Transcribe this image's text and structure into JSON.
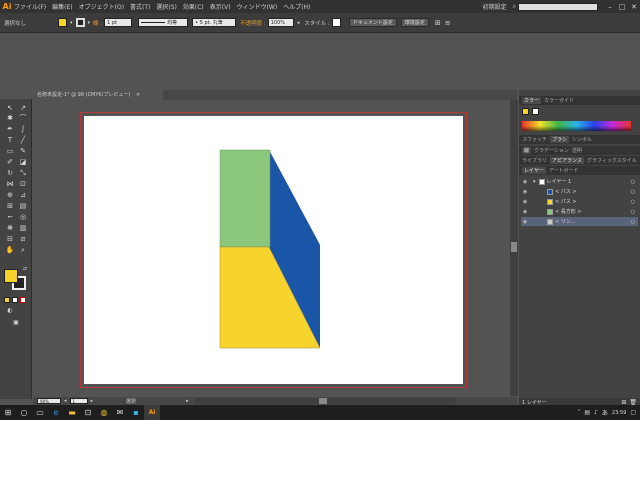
{
  "app": {
    "logo": "Ai",
    "menus": [
      "ファイル(F)",
      "編集(E)",
      "オブジェクト(O)",
      "書式(T)",
      "選択(S)",
      "効果(C)",
      "表示(V)",
      "ウィンドウ(W)",
      "ヘルプ(H)"
    ],
    "workspace": "初期設定",
    "search_placeholder": "",
    "window_controls": [
      "–",
      "□",
      "✕"
    ]
  },
  "control_bar": {
    "selection": "選択なし",
    "stroke_label": "線 :",
    "stroke_width": "1 pt",
    "stroke_style": "均等",
    "brush": "5 pt. 丸筆",
    "opacity_label": "不透明度 :",
    "opacity": "100%",
    "style_label": "スタイル :",
    "doc_settings_button": "ドキュメント設定",
    "prefs_button": "環境設定",
    "fill_color": "#f6d32d",
    "stroke_color": "#000000"
  },
  "document": {
    "tab_title": "名称未設定-1* @ 98 (CMYK/プレビュー)",
    "zoom": "98%",
    "page": "1",
    "status_text": "選択"
  },
  "shapes": {
    "green_fill": "#8bc77b",
    "yellow_fill": "#f6d32d",
    "blue_fill": "#1a56a7"
  },
  "panels": {
    "color_tabs": [
      "カラー",
      "カラーガイド"
    ],
    "stroke_tabs": [
      "スウォッチ",
      "ブラシ",
      "シンボル"
    ],
    "gradient_tabs": [
      "線",
      "グラデーション",
      "透明"
    ],
    "appearance_tabs": [
      "ライブラリ",
      "アピアランス",
      "グラフィックスタイル"
    ],
    "layer_tabs": [
      "レイヤー",
      "アートボード"
    ],
    "layers": [
      {
        "name": "レイヤー 1",
        "indent": 0
      },
      {
        "name": "< パス >",
        "indent": 1
      },
      {
        "name": "< パス >",
        "indent": 1
      },
      {
        "name": "< 長方形 >",
        "indent": 1
      },
      {
        "name": "< リン...",
        "indent": 1
      }
    ],
    "layer_count": "1 レイヤー"
  },
  "taskbar": {
    "time": "23:59"
  }
}
